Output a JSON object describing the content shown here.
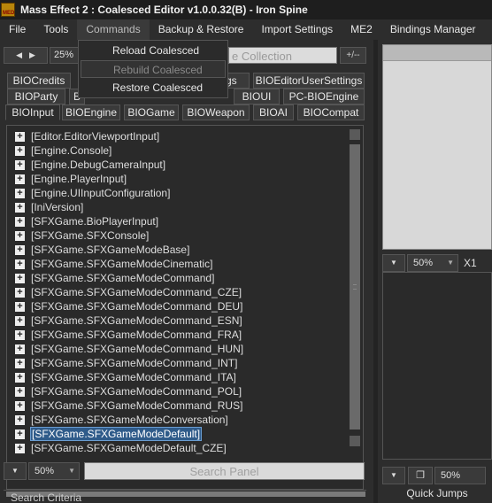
{
  "window": {
    "title": "Mass Effect 2 : Coalesced Editor v1.0.0.32(B) - Iron Spine",
    "app_icon_text": "MED"
  },
  "menubar": [
    "File",
    "Tools",
    "Commands",
    "Backup & Restore",
    "Import Settings",
    "ME2",
    "Bindings Manager"
  ],
  "commands_menu": [
    "Reload Coalesced",
    "Rebuild Coalesced",
    "Restore Coalesced"
  ],
  "toolbar": {
    "back_glyph": "◀",
    "forward_glyph": "▶",
    "zoom": "25%",
    "collection_placeholder": "e Collection",
    "add_label": "+/--"
  },
  "tabs": {
    "row1": [
      "BIOCredits",
      "gs",
      "BIOEditorUserSettings"
    ],
    "row2": [
      "BIOParty",
      "B",
      "BIOUI",
      "PC-BIOEngine"
    ],
    "row3": [
      "BIOInput",
      "BIOEngine",
      "BIOGame",
      "BIOWeapon",
      "BIOAI",
      "BIOCompat"
    ]
  },
  "tree_items": [
    "[Editor.EditorViewportInput]",
    "[Engine.Console]",
    "[Engine.DebugCameraInput]",
    "[Engine.PlayerInput]",
    "[Engine.UIInputConfiguration]",
    "[IniVersion]",
    "[SFXGame.BioPlayerInput]",
    "[SFXGame.SFXConsole]",
    "[SFXGame.SFXGameModeBase]",
    "[SFXGame.SFXGameModeCinematic]",
    "[SFXGame.SFXGameModeCommand]",
    "[SFXGame.SFXGameModeCommand_CZE]",
    "[SFXGame.SFXGameModeCommand_DEU]",
    "[SFXGame.SFXGameModeCommand_ESN]",
    "[SFXGame.SFXGameModeCommand_FRA]",
    "[SFXGame.SFXGameModeCommand_HUN]",
    "[SFXGame.SFXGameModeCommand_INT]",
    "[SFXGame.SFXGameModeCommand_ITA]",
    "[SFXGame.SFXGameModeCommand_POL]",
    "[SFXGame.SFXGameModeCommand_RUS]",
    "[SFXGame.SFXGameModeConversation]",
    "[SFXGame.SFXGameModeDefault]",
    "[SFXGame.SFXGameModeDefault_CZE]"
  ],
  "selected_index": 21,
  "bottom": {
    "zoom": "50%",
    "search_placeholder": "Search Panel",
    "search_criteria": "Search Criteria"
  },
  "right": {
    "zoom1": "50%",
    "mult": "X1",
    "zoom2": "50%",
    "quick_jumps": "Quick Jumps"
  }
}
